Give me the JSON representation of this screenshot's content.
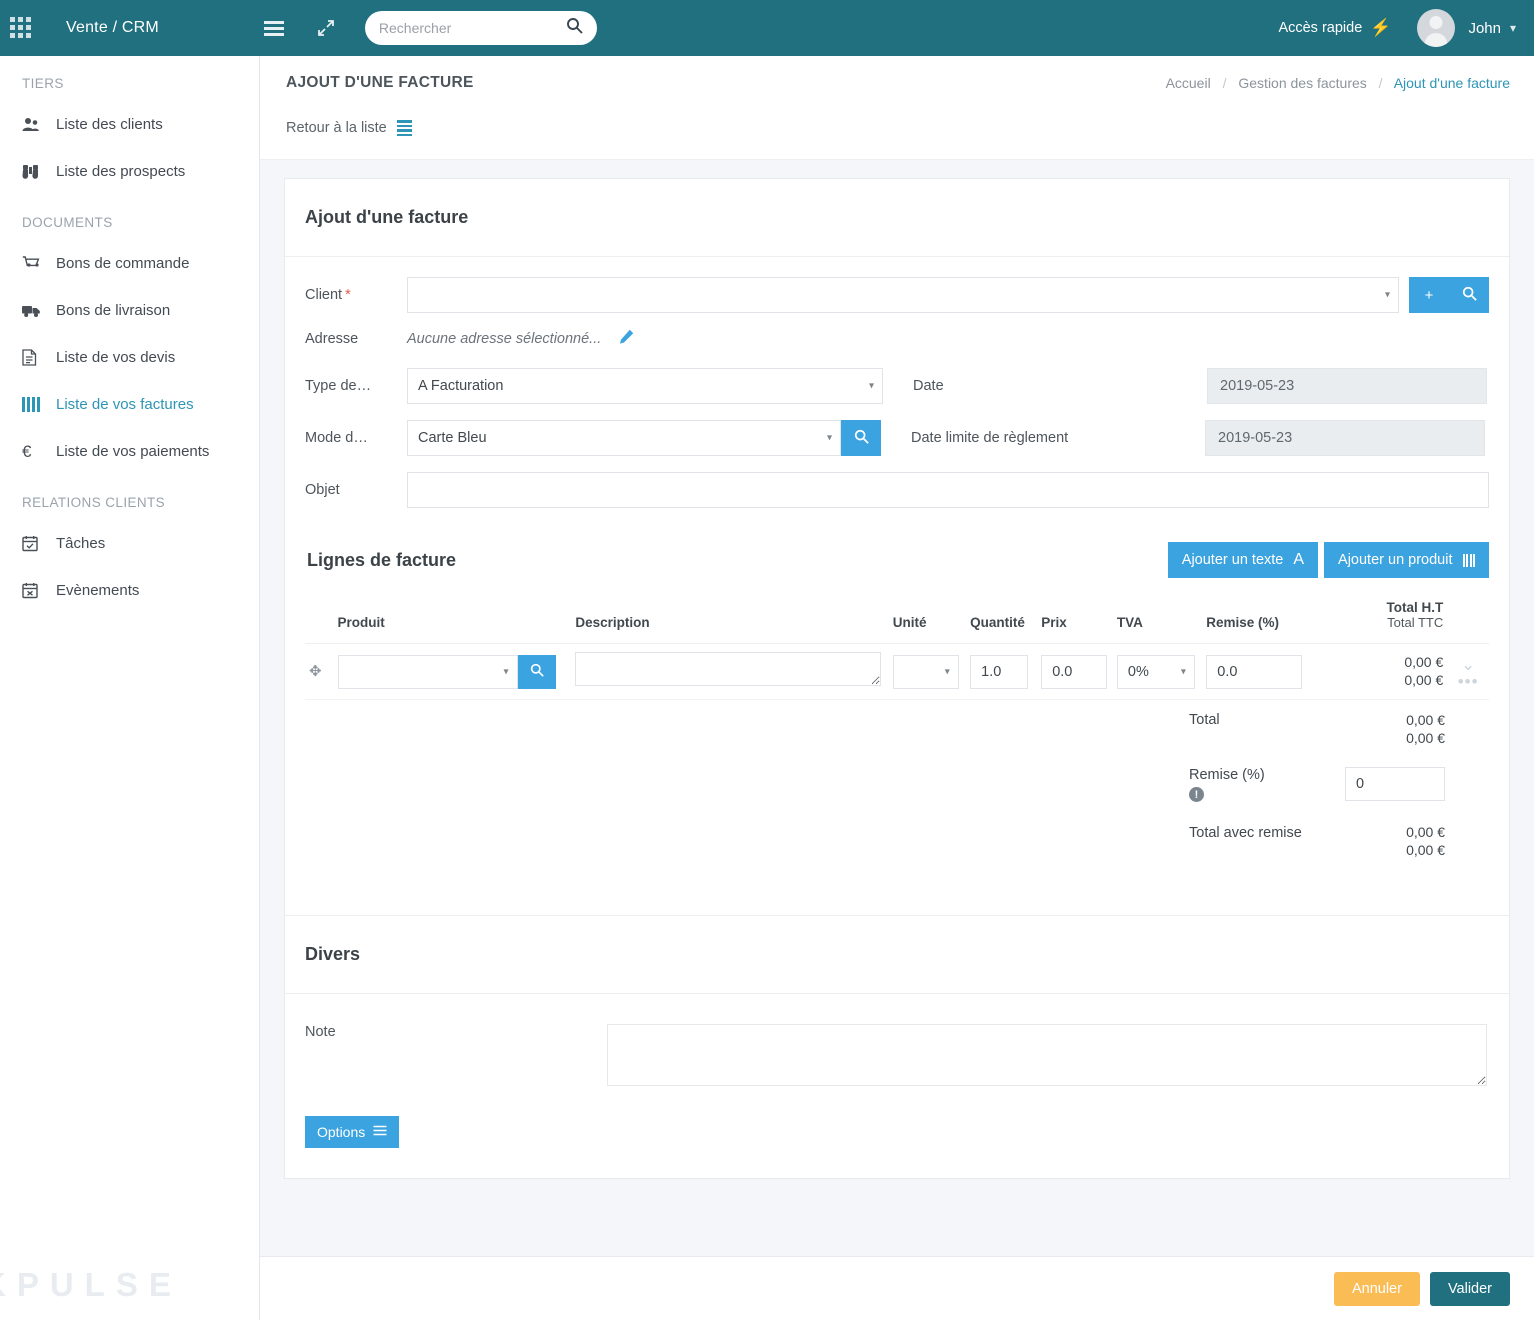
{
  "topbar": {
    "apps_icon": "grid-apps-icon",
    "brand": "Vente / CRM",
    "menu_icon": "hamburger-icon",
    "expand_icon": "fullscreen-expand-icon",
    "search_placeholder": "Rechercher",
    "search_value": "",
    "search_icon": "search-icon",
    "quick_access": "Accès rapide",
    "bolt_icon": "lightning-bolt-icon",
    "user_name": "John",
    "caret_icon": "chevron-down-icon",
    "bg_color": "#20707f"
  },
  "sidebar": {
    "watermark": "KPULSE",
    "groups": [
      {
        "title": "TIERS",
        "items": [
          {
            "label": "Liste des clients",
            "icon": "users-icon",
            "active": false
          },
          {
            "label": "Liste des prospects",
            "icon": "binoculars-icon",
            "active": false
          }
        ]
      },
      {
        "title": "DOCUMENTS",
        "items": [
          {
            "label": "Bons de commande",
            "icon": "shopping-cart-icon",
            "active": false
          },
          {
            "label": "Bons de livraison",
            "icon": "truck-icon",
            "active": false
          },
          {
            "label": "Liste de vos devis",
            "icon": "document-icon",
            "active": false
          },
          {
            "label": "Liste de vos factures",
            "icon": "barcode-icon",
            "active": true
          },
          {
            "label": "Liste de vos paiements",
            "icon": "euro-icon",
            "active": false
          }
        ]
      },
      {
        "title": "RELATIONS CLIENTS",
        "items": [
          {
            "label": "Tâches",
            "icon": "calendar-check-icon",
            "active": false
          },
          {
            "label": "Evènements",
            "icon": "calendar-times-icon",
            "active": false
          }
        ]
      }
    ]
  },
  "page": {
    "title": "AJOUT D'UNE FACTURE",
    "breadcrumb": [
      "Accueil",
      "Gestion des factures",
      "Ajout d'une facture"
    ],
    "back_to_list": "Retour à la liste",
    "back_icon": "list-icon"
  },
  "card": {
    "title": "Ajout d'une facture"
  },
  "form": {
    "client_label": "Client",
    "client_required": "*",
    "client_value": "",
    "client_add_icon": "plus-icon",
    "client_search_icon": "search-icon",
    "adresse_label": "Adresse",
    "adresse_value": "Aucune adresse sélectionné...",
    "adresse_edit_icon": "pencil-icon",
    "type_label": "Type de…",
    "type_value": "A Facturation",
    "mode_label": "Mode d…",
    "mode_value": "Carte Bleu",
    "mode_search_icon": "search-icon",
    "objet_label": "Objet",
    "objet_value": "",
    "date_label": "Date",
    "date_value": "2019-05-23",
    "date_limite_label": "Date limite de règlement",
    "date_limite_value": "2019-05-23"
  },
  "lines": {
    "title": "Lignes de facture",
    "add_text_btn": "Ajouter un texte",
    "add_text_icon": "letter-a-icon",
    "add_product_btn": "Ajouter un produit",
    "add_product_icon": "barcode-icon",
    "columns": {
      "produit": "Produit",
      "description": "Description",
      "unite": "Unité",
      "quantite": "Quantité",
      "prix": "Prix",
      "tva": "TVA",
      "remise": "Remise (%)",
      "total_ht": "Total H.T",
      "total_ttc": "Total TTC"
    },
    "rows": [
      {
        "drag_icon": "drag-handle-icon",
        "produit": "",
        "produit_search_icon": "search-icon",
        "description": "",
        "unite": "",
        "quantite": "1.0",
        "prix": "0.0",
        "tva": "0%",
        "remise": "0.0",
        "total_ht": "0,00 €",
        "total_ttc": "0,00 €",
        "expand_icon": "chevron-down-icon",
        "more_icon": "ellipsis-icon"
      }
    ],
    "totals": {
      "total_label": "Total",
      "total_ht": "0,00 €",
      "total_ttc": "0,00 €",
      "remise_label": "Remise (%)",
      "remise_info_icon": "info-icon",
      "remise_value": "0",
      "total_remise_label": "Total avec remise",
      "total_remise_ht": "0,00 €",
      "total_remise_ttc": "0,00 €"
    }
  },
  "divers": {
    "title": "Divers",
    "note_label": "Note",
    "note_value": "",
    "options_btn": "Options",
    "options_icon": "sliders-icon"
  },
  "footer": {
    "cancel": "Annuler",
    "validate": "Valider",
    "cancel_color": "#fabd55",
    "validate_color": "#20707f"
  }
}
